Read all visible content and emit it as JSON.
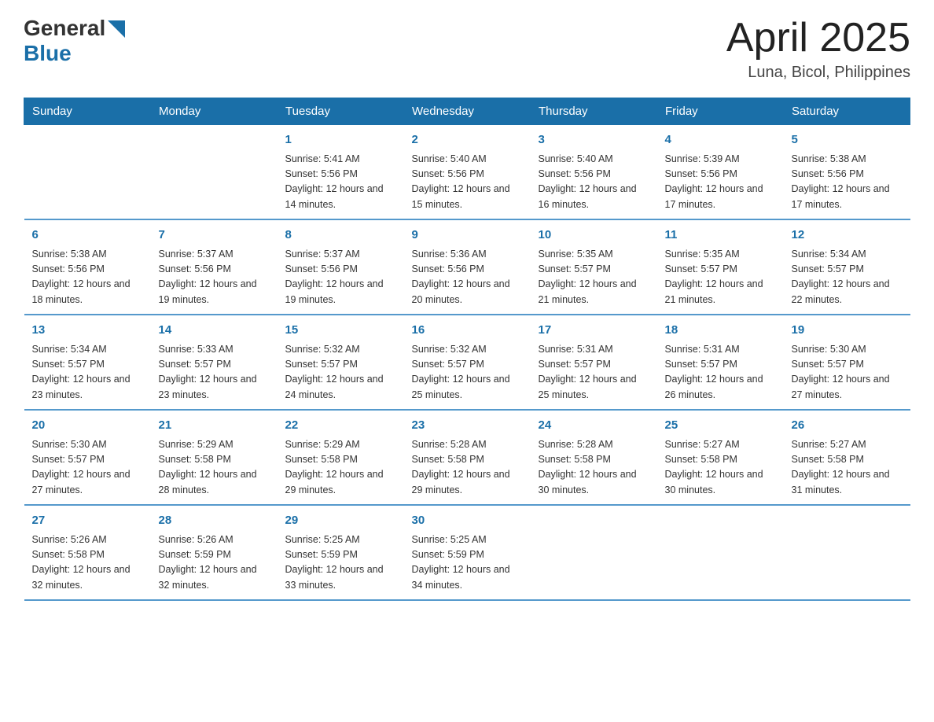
{
  "header": {
    "logo_general": "General",
    "logo_blue": "Blue",
    "month_title": "April 2025",
    "location": "Luna, Bicol, Philippines"
  },
  "weekdays": [
    "Sunday",
    "Monday",
    "Tuesday",
    "Wednesday",
    "Thursday",
    "Friday",
    "Saturday"
  ],
  "weeks": [
    [
      {
        "day": "",
        "sunrise": "",
        "sunset": "",
        "daylight": ""
      },
      {
        "day": "",
        "sunrise": "",
        "sunset": "",
        "daylight": ""
      },
      {
        "day": "1",
        "sunrise": "Sunrise: 5:41 AM",
        "sunset": "Sunset: 5:56 PM",
        "daylight": "Daylight: 12 hours and 14 minutes."
      },
      {
        "day": "2",
        "sunrise": "Sunrise: 5:40 AM",
        "sunset": "Sunset: 5:56 PM",
        "daylight": "Daylight: 12 hours and 15 minutes."
      },
      {
        "day": "3",
        "sunrise": "Sunrise: 5:40 AM",
        "sunset": "Sunset: 5:56 PM",
        "daylight": "Daylight: 12 hours and 16 minutes."
      },
      {
        "day": "4",
        "sunrise": "Sunrise: 5:39 AM",
        "sunset": "Sunset: 5:56 PM",
        "daylight": "Daylight: 12 hours and 17 minutes."
      },
      {
        "day": "5",
        "sunrise": "Sunrise: 5:38 AM",
        "sunset": "Sunset: 5:56 PM",
        "daylight": "Daylight: 12 hours and 17 minutes."
      }
    ],
    [
      {
        "day": "6",
        "sunrise": "Sunrise: 5:38 AM",
        "sunset": "Sunset: 5:56 PM",
        "daylight": "Daylight: 12 hours and 18 minutes."
      },
      {
        "day": "7",
        "sunrise": "Sunrise: 5:37 AM",
        "sunset": "Sunset: 5:56 PM",
        "daylight": "Daylight: 12 hours and 19 minutes."
      },
      {
        "day": "8",
        "sunrise": "Sunrise: 5:37 AM",
        "sunset": "Sunset: 5:56 PM",
        "daylight": "Daylight: 12 hours and 19 minutes."
      },
      {
        "day": "9",
        "sunrise": "Sunrise: 5:36 AM",
        "sunset": "Sunset: 5:56 PM",
        "daylight": "Daylight: 12 hours and 20 minutes."
      },
      {
        "day": "10",
        "sunrise": "Sunrise: 5:35 AM",
        "sunset": "Sunset: 5:57 PM",
        "daylight": "Daylight: 12 hours and 21 minutes."
      },
      {
        "day": "11",
        "sunrise": "Sunrise: 5:35 AM",
        "sunset": "Sunset: 5:57 PM",
        "daylight": "Daylight: 12 hours and 21 minutes."
      },
      {
        "day": "12",
        "sunrise": "Sunrise: 5:34 AM",
        "sunset": "Sunset: 5:57 PM",
        "daylight": "Daylight: 12 hours and 22 minutes."
      }
    ],
    [
      {
        "day": "13",
        "sunrise": "Sunrise: 5:34 AM",
        "sunset": "Sunset: 5:57 PM",
        "daylight": "Daylight: 12 hours and 23 minutes."
      },
      {
        "day": "14",
        "sunrise": "Sunrise: 5:33 AM",
        "sunset": "Sunset: 5:57 PM",
        "daylight": "Daylight: 12 hours and 23 minutes."
      },
      {
        "day": "15",
        "sunrise": "Sunrise: 5:32 AM",
        "sunset": "Sunset: 5:57 PM",
        "daylight": "Daylight: 12 hours and 24 minutes."
      },
      {
        "day": "16",
        "sunrise": "Sunrise: 5:32 AM",
        "sunset": "Sunset: 5:57 PM",
        "daylight": "Daylight: 12 hours and 25 minutes."
      },
      {
        "day": "17",
        "sunrise": "Sunrise: 5:31 AM",
        "sunset": "Sunset: 5:57 PM",
        "daylight": "Daylight: 12 hours and 25 minutes."
      },
      {
        "day": "18",
        "sunrise": "Sunrise: 5:31 AM",
        "sunset": "Sunset: 5:57 PM",
        "daylight": "Daylight: 12 hours and 26 minutes."
      },
      {
        "day": "19",
        "sunrise": "Sunrise: 5:30 AM",
        "sunset": "Sunset: 5:57 PM",
        "daylight": "Daylight: 12 hours and 27 minutes."
      }
    ],
    [
      {
        "day": "20",
        "sunrise": "Sunrise: 5:30 AM",
        "sunset": "Sunset: 5:57 PM",
        "daylight": "Daylight: 12 hours and 27 minutes."
      },
      {
        "day": "21",
        "sunrise": "Sunrise: 5:29 AM",
        "sunset": "Sunset: 5:58 PM",
        "daylight": "Daylight: 12 hours and 28 minutes."
      },
      {
        "day": "22",
        "sunrise": "Sunrise: 5:29 AM",
        "sunset": "Sunset: 5:58 PM",
        "daylight": "Daylight: 12 hours and 29 minutes."
      },
      {
        "day": "23",
        "sunrise": "Sunrise: 5:28 AM",
        "sunset": "Sunset: 5:58 PM",
        "daylight": "Daylight: 12 hours and 29 minutes."
      },
      {
        "day": "24",
        "sunrise": "Sunrise: 5:28 AM",
        "sunset": "Sunset: 5:58 PM",
        "daylight": "Daylight: 12 hours and 30 minutes."
      },
      {
        "day": "25",
        "sunrise": "Sunrise: 5:27 AM",
        "sunset": "Sunset: 5:58 PM",
        "daylight": "Daylight: 12 hours and 30 minutes."
      },
      {
        "day": "26",
        "sunrise": "Sunrise: 5:27 AM",
        "sunset": "Sunset: 5:58 PM",
        "daylight": "Daylight: 12 hours and 31 minutes."
      }
    ],
    [
      {
        "day": "27",
        "sunrise": "Sunrise: 5:26 AM",
        "sunset": "Sunset: 5:58 PM",
        "daylight": "Daylight: 12 hours and 32 minutes."
      },
      {
        "day": "28",
        "sunrise": "Sunrise: 5:26 AM",
        "sunset": "Sunset: 5:59 PM",
        "daylight": "Daylight: 12 hours and 32 minutes."
      },
      {
        "day": "29",
        "sunrise": "Sunrise: 5:25 AM",
        "sunset": "Sunset: 5:59 PM",
        "daylight": "Daylight: 12 hours and 33 minutes."
      },
      {
        "day": "30",
        "sunrise": "Sunrise: 5:25 AM",
        "sunset": "Sunset: 5:59 PM",
        "daylight": "Daylight: 12 hours and 34 minutes."
      },
      {
        "day": "",
        "sunrise": "",
        "sunset": "",
        "daylight": ""
      },
      {
        "day": "",
        "sunrise": "",
        "sunset": "",
        "daylight": ""
      },
      {
        "day": "",
        "sunrise": "",
        "sunset": "",
        "daylight": ""
      }
    ]
  ]
}
